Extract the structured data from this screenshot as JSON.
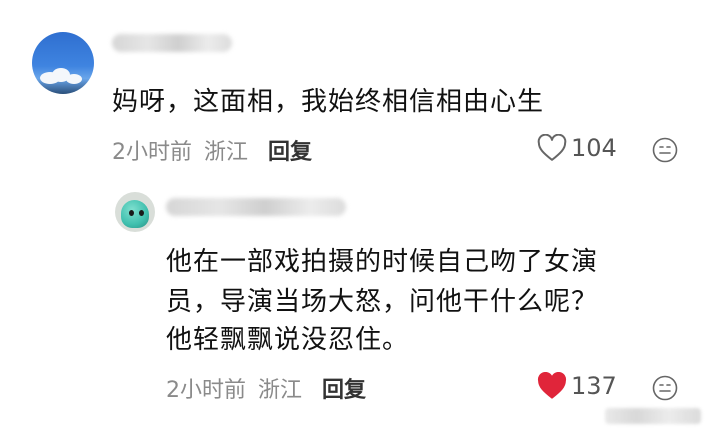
{
  "comment": {
    "username": "",
    "text": "妈呀，这面相，我始终相信相由心生",
    "time": "2小时前",
    "location": "浙江",
    "reply_label": "回复",
    "likes": "104",
    "liked": false
  },
  "reply": {
    "username": "",
    "text_lines": [
      "他在一部戏拍摄的时候自己吻了女演",
      "员，导演当场大怒，问他干什么呢？",
      "他轻飘飘说没忍住。"
    ],
    "time": "2小时前",
    "location": "浙江",
    "reply_label": "回复",
    "likes": "137",
    "liked": true,
    "like_color": "#e0253a"
  },
  "icons": {
    "like_outline": "heart-outline-icon",
    "like_filled": "heart-filled-icon",
    "reaction": "smiley-face-icon"
  }
}
